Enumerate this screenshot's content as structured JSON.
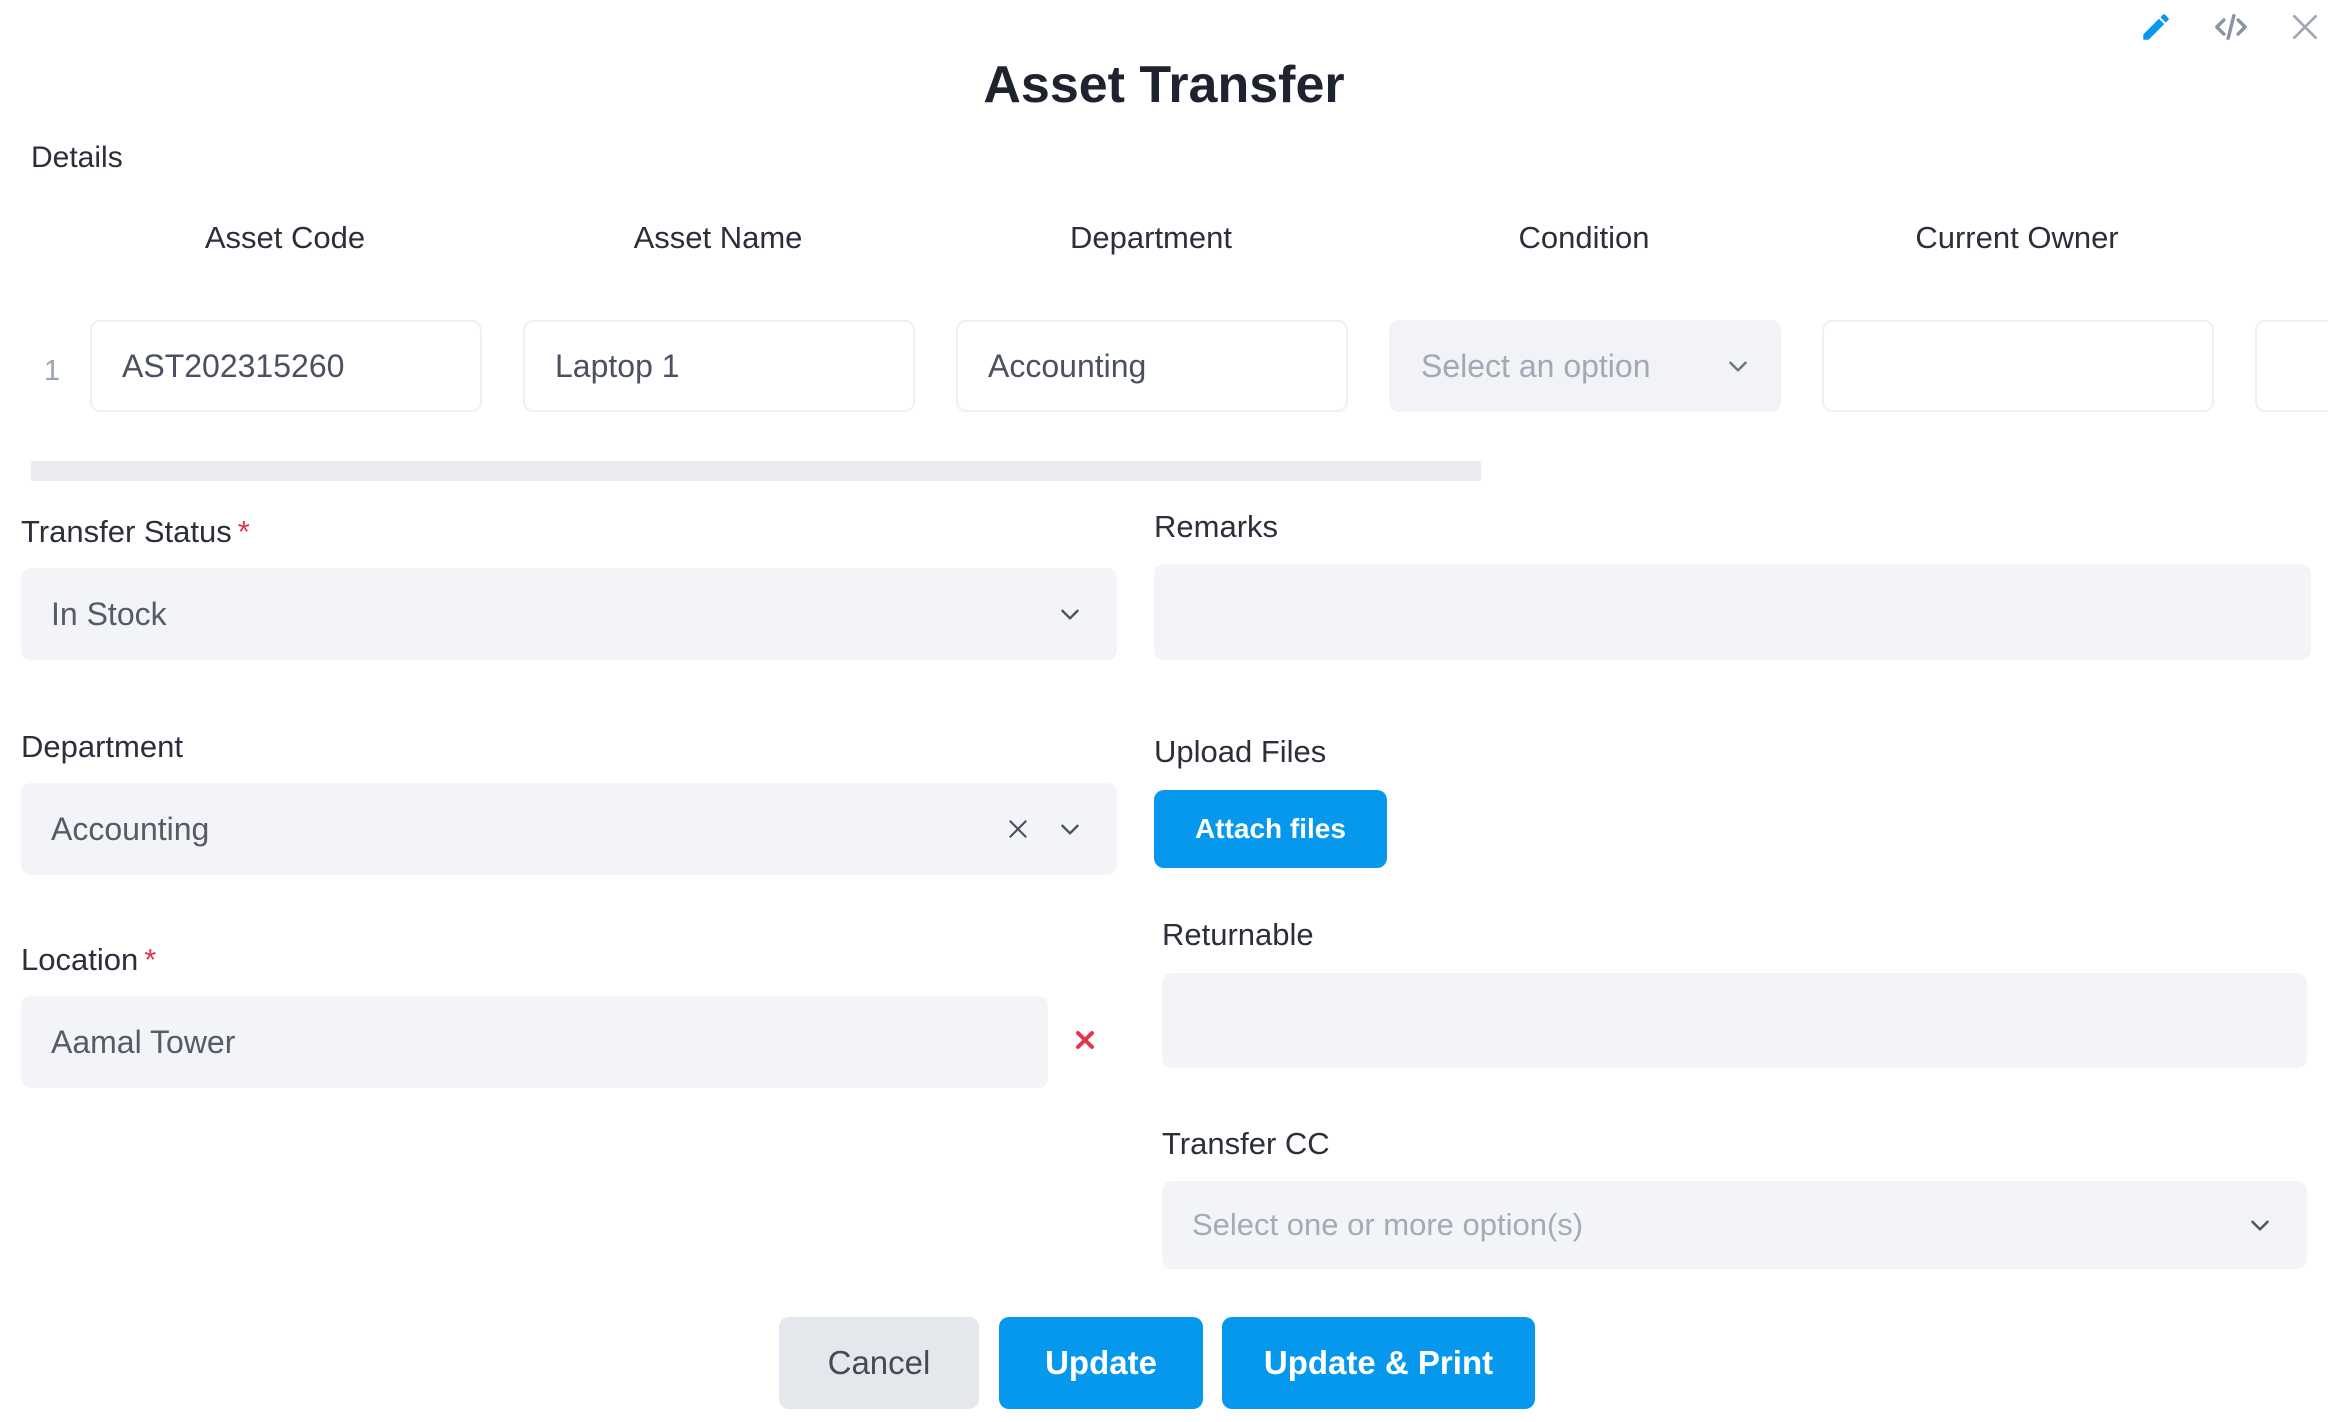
{
  "dialog": {
    "title": "Asset Transfer",
    "icons": {
      "edit": "pencil-icon",
      "code": "code-icon",
      "close": "close-icon"
    }
  },
  "details": {
    "label": "Details",
    "columns": [
      "Asset Code",
      "Asset Name",
      "Department",
      "Condition",
      "Current Owner"
    ],
    "rows": [
      {
        "index": "1",
        "asset_code": "AST202315260",
        "asset_name": "Laptop 1",
        "department": "Accounting",
        "condition_placeholder": "Select an option",
        "current_owner": ""
      }
    ]
  },
  "form": {
    "transfer_status": {
      "label": "Transfer Status",
      "required": "*",
      "value": "In Stock"
    },
    "department": {
      "label": "Department",
      "value": "Accounting"
    },
    "location": {
      "label": "Location",
      "required": "*",
      "value": "Aamal Tower"
    },
    "remarks": {
      "label": "Remarks",
      "value": ""
    },
    "upload_files": {
      "label": "Upload Files",
      "button": "Attach files"
    },
    "returnable": {
      "label": "Returnable",
      "value": ""
    },
    "transfer_cc": {
      "label": "Transfer CC",
      "placeholder": "Select one or more option(s)"
    }
  },
  "actions": {
    "cancel": "Cancel",
    "update": "Update",
    "update_print": "Update & Print"
  },
  "colors": {
    "primary": "#0598ec",
    "required": "#e3344f",
    "field_bg": "#f2f4f7"
  }
}
